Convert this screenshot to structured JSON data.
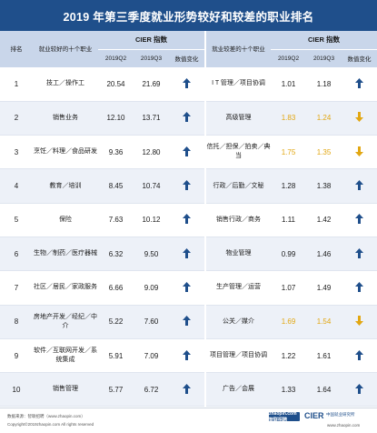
{
  "title": "2019 年第三季度就业形势较好和较差的职业排名",
  "headers": {
    "rank": "排名",
    "good_job": "就业较好的十个职业",
    "bad_job": "就业较差的十个职业",
    "cier_index": "CIER 指数",
    "q2": "2019Q2",
    "q3": "2019Q3",
    "change": "数值变化"
  },
  "rows": [
    {
      "rank": "1",
      "good": "技工／操作工",
      "g_q2": "20.54",
      "g_q3": "21.69",
      "g_dir": "up",
      "bad": "I T 管理／项目协调",
      "b_q2": "1.01",
      "b_q3": "1.18",
      "b_dir": "up",
      "b_warn": false
    },
    {
      "rank": "2",
      "good": "销售业务",
      "g_q2": "12.10",
      "g_q3": "13.71",
      "g_dir": "up",
      "bad": "高级管理",
      "b_q2": "1.83",
      "b_q3": "1.24",
      "b_dir": "down",
      "b_warn": true
    },
    {
      "rank": "3",
      "good": "烹饪／料理／食品研发",
      "g_q2": "9.36",
      "g_q3": "12.80",
      "g_dir": "up",
      "bad": "信托／担保／拍卖／典当",
      "b_q2": "1.75",
      "b_q3": "1.35",
      "b_dir": "down",
      "b_warn": true
    },
    {
      "rank": "4",
      "good": "教育／培训",
      "g_q2": "8.45",
      "g_q3": "10.74",
      "g_dir": "up",
      "bad": "行政／后勤／文秘",
      "b_q2": "1.28",
      "b_q3": "1.38",
      "b_dir": "up",
      "b_warn": false
    },
    {
      "rank": "5",
      "good": "保险",
      "g_q2": "7.63",
      "g_q3": "10.12",
      "g_dir": "up",
      "bad": "销售行政／商务",
      "b_q2": "1.11",
      "b_q3": "1.42",
      "b_dir": "up",
      "b_warn": false
    },
    {
      "rank": "6",
      "good": "生物／制药／医疗器械",
      "g_q2": "6.32",
      "g_q3": "9.50",
      "g_dir": "up",
      "bad": "物业管理",
      "b_q2": "0.99",
      "b_q3": "1.46",
      "b_dir": "up",
      "b_warn": false
    },
    {
      "rank": "7",
      "good": "社区／居民／家政服务",
      "g_q2": "6.66",
      "g_q3": "9.09",
      "g_dir": "up",
      "bad": "生产管理／运营",
      "b_q2": "1.07",
      "b_q3": "1.49",
      "b_dir": "up",
      "b_warn": false
    },
    {
      "rank": "8",
      "good": "房地产开发／经纪／中介",
      "g_q2": "5.22",
      "g_q3": "7.60",
      "g_dir": "up",
      "bad": "公关／媒介",
      "b_q2": "1.69",
      "b_q3": "1.54",
      "b_dir": "down",
      "b_warn": true
    },
    {
      "rank": "9",
      "good": "软件／互联网开发／系统集成",
      "g_q2": "5.91",
      "g_q3": "7.09",
      "g_dir": "up",
      "bad": "项目管理／项目协调",
      "b_q2": "1.22",
      "b_q3": "1.61",
      "b_dir": "up",
      "b_warn": false
    },
    {
      "rank": "10",
      "good": "销售管理",
      "g_q2": "5.77",
      "g_q3": "6.72",
      "g_dir": "up",
      "bad": "广告／会展",
      "b_q2": "1.33",
      "b_q3": "1.64",
      "b_dir": "up",
      "b_warn": false
    }
  ],
  "colors": {
    "up": "#1f4f8b",
    "down": "#e2a712",
    "header_bg": "#c9d6ea",
    "title_bg": "#1f4f8b"
  },
  "icons": {
    "up": "arrow-up-icon",
    "down": "arrow-down-icon"
  },
  "footer": {
    "source": "数据来源：智联招聘（www.zhaopin.com）",
    "copyright": "Copyright©2019zhaopin.com All rights reserved",
    "logo_zhaopin": "zhaopin.com 智联招聘",
    "logo_cier": "CIER",
    "logo_cier_sub": "中国就业研究所",
    "site": "www.zhaopin.com"
  }
}
